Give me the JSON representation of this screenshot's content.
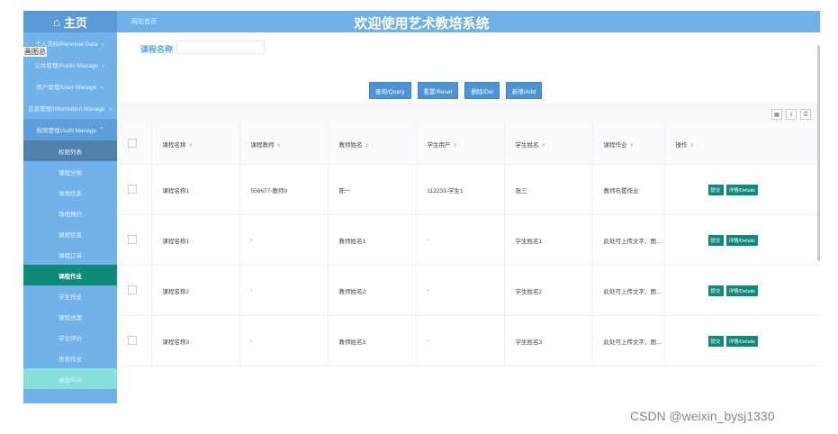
{
  "header": {
    "home_label": "主页",
    "breadcrumb": "网站首页",
    "system_title": "欢迎使用艺术教培系统"
  },
  "sidebar": {
    "overlay_text": "画图总",
    "groups": [
      {
        "label": "个人资料/Personal Data"
      },
      {
        "label": "公共管理/Public Manage"
      },
      {
        "label": "用户管理/User Manage"
      },
      {
        "label": "信息管理/Information Manage"
      },
      {
        "label": "权限管理/Auth Manage"
      }
    ],
    "items": [
      {
        "label": "权限列表"
      },
      {
        "label": "课程分类"
      },
      {
        "label": "场地信息"
      },
      {
        "label": "场地预约"
      },
      {
        "label": "课程信息"
      },
      {
        "label": "课程订单"
      },
      {
        "label": "课程作业"
      },
      {
        "label": "学生作业"
      },
      {
        "label": "课程进度"
      },
      {
        "label": "学生评价"
      },
      {
        "label": "优秀作业"
      },
      {
        "label": "退出/Exit"
      }
    ]
  },
  "search": {
    "label": "课程名称",
    "value": ""
  },
  "buttons": {
    "query": "查询/Query",
    "reset": "重置/Reset",
    "del": "删除/Del",
    "add": "新增/Add"
  },
  "table": {
    "headers": [
      "课程名称",
      "课程教师",
      "教师姓名",
      "学生用户",
      "学生姓名",
      "课程作业",
      "操作"
    ],
    "rows": [
      {
        "c1": "课程名称1",
        "c2": "556677-教师9",
        "c3": "陈一",
        "c4": "112233-学生1",
        "c5": "张三",
        "c6": "教师布置作业"
      },
      {
        "c1": "课程名称1",
        "c2": "-",
        "c3": "教师姓名1",
        "c4": "-",
        "c5": "学生姓名1",
        "c6": "此处可上传文字、图..."
      },
      {
        "c1": "课程名称2",
        "c2": "-",
        "c3": "教师姓名2",
        "c4": "-",
        "c5": "学生姓名2",
        "c6": "此处可上传文字、图..."
      },
      {
        "c1": "课程名称3",
        "c2": "-",
        "c3": "教师姓名3",
        "c4": "-",
        "c5": "学生姓名3",
        "c6": "此处可上传文字、图..."
      }
    ],
    "submit_label": "提交",
    "details_label": "详情/Details"
  },
  "watermark": "CSDN @weixin_bysj1330",
  "colors": {
    "topbar": "#6fb1e8",
    "sidebar": "#72b2ea",
    "active_item": "#0e8a7b",
    "button_blue": "#4d94d6"
  }
}
